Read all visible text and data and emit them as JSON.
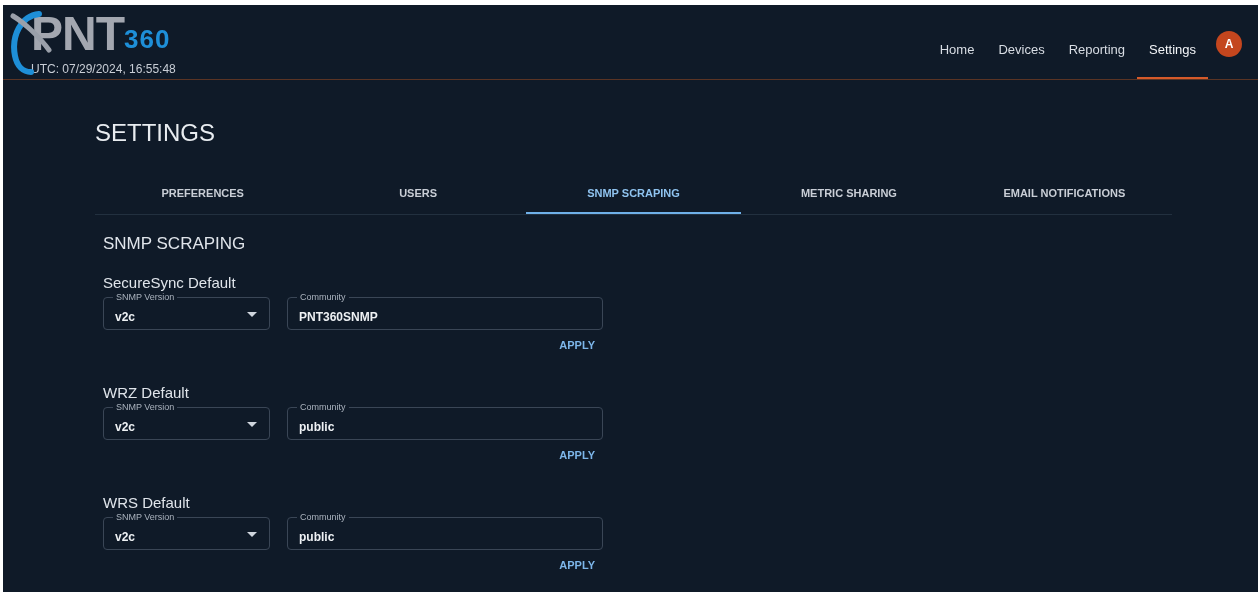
{
  "header": {
    "logo": {
      "main": "PNT",
      "suffix": "360"
    },
    "clock": "UTC: 07/29/2024, 16:55:48",
    "nav": [
      {
        "label": "Home",
        "selected": false
      },
      {
        "label": "Devices",
        "selected": false
      },
      {
        "label": "Reporting",
        "selected": false
      },
      {
        "label": "Settings",
        "selected": true
      }
    ],
    "avatar": "A"
  },
  "page_title": "SETTINGS",
  "tabs": [
    {
      "label": "PREFERENCES",
      "selected": false
    },
    {
      "label": "USERS",
      "selected": false
    },
    {
      "label": "SNMP SCRAPING",
      "selected": true
    },
    {
      "label": "METRIC SHARING",
      "selected": false
    },
    {
      "label": "EMAIL NOTIFICATIONS",
      "selected": false
    }
  ],
  "section_title": "SNMP SCRAPING",
  "groups": [
    {
      "title": "SecureSync Default",
      "version_label": "SNMP Version",
      "version": "v2c",
      "community_label": "Community",
      "community": "PNT360SNMP",
      "button": "APPLY"
    },
    {
      "title": "WRZ Default",
      "version_label": "SNMP Version",
      "version": "v2c",
      "community_label": "Community",
      "community": "public",
      "button": "APPLY"
    },
    {
      "title": "WRS Default",
      "version_label": "SNMP Version",
      "version": "v2c",
      "community_label": "Community",
      "community": "public",
      "button": "APPLY"
    }
  ]
}
